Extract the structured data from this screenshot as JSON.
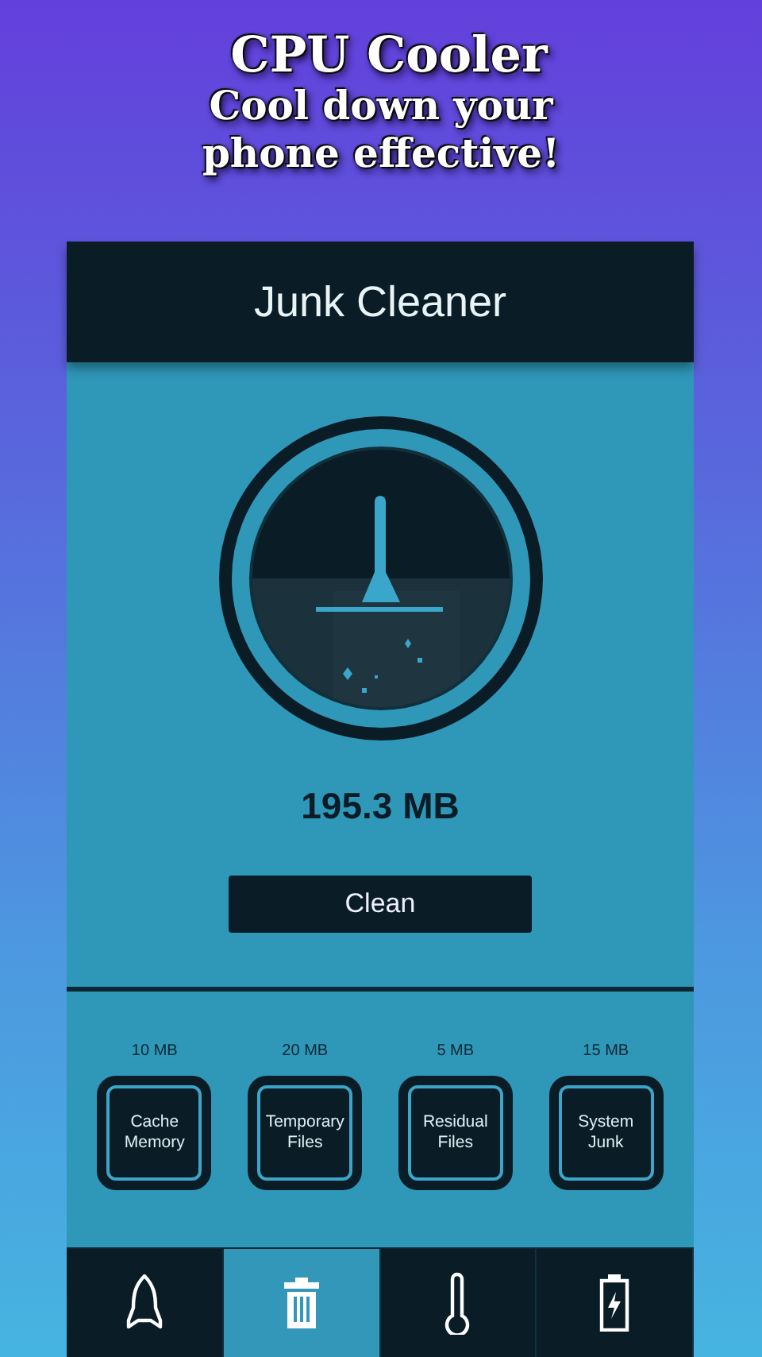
{
  "promo": {
    "title": "CPU Cooler",
    "subtitle_lines": [
      "Cool down your",
      "phone effective!"
    ]
  },
  "app_bar": {
    "title": "Junk Cleaner"
  },
  "cleaner": {
    "amount": "195.3 MB",
    "button": "Clean"
  },
  "categories": [
    {
      "size": "10 MB",
      "label": "Cache Memory"
    },
    {
      "size": "20 MB",
      "label": "Temporary Files"
    },
    {
      "size": "5 MB",
      "label": "Residual Files"
    },
    {
      "size": "15 MB",
      "label": "System Junk"
    }
  ],
  "nav_tabs": [
    {
      "kind": "rocket",
      "selected": false
    },
    {
      "kind": "trash",
      "selected": true
    },
    {
      "kind": "thermometer",
      "selected": false
    },
    {
      "kind": "battery",
      "selected": false
    }
  ]
}
